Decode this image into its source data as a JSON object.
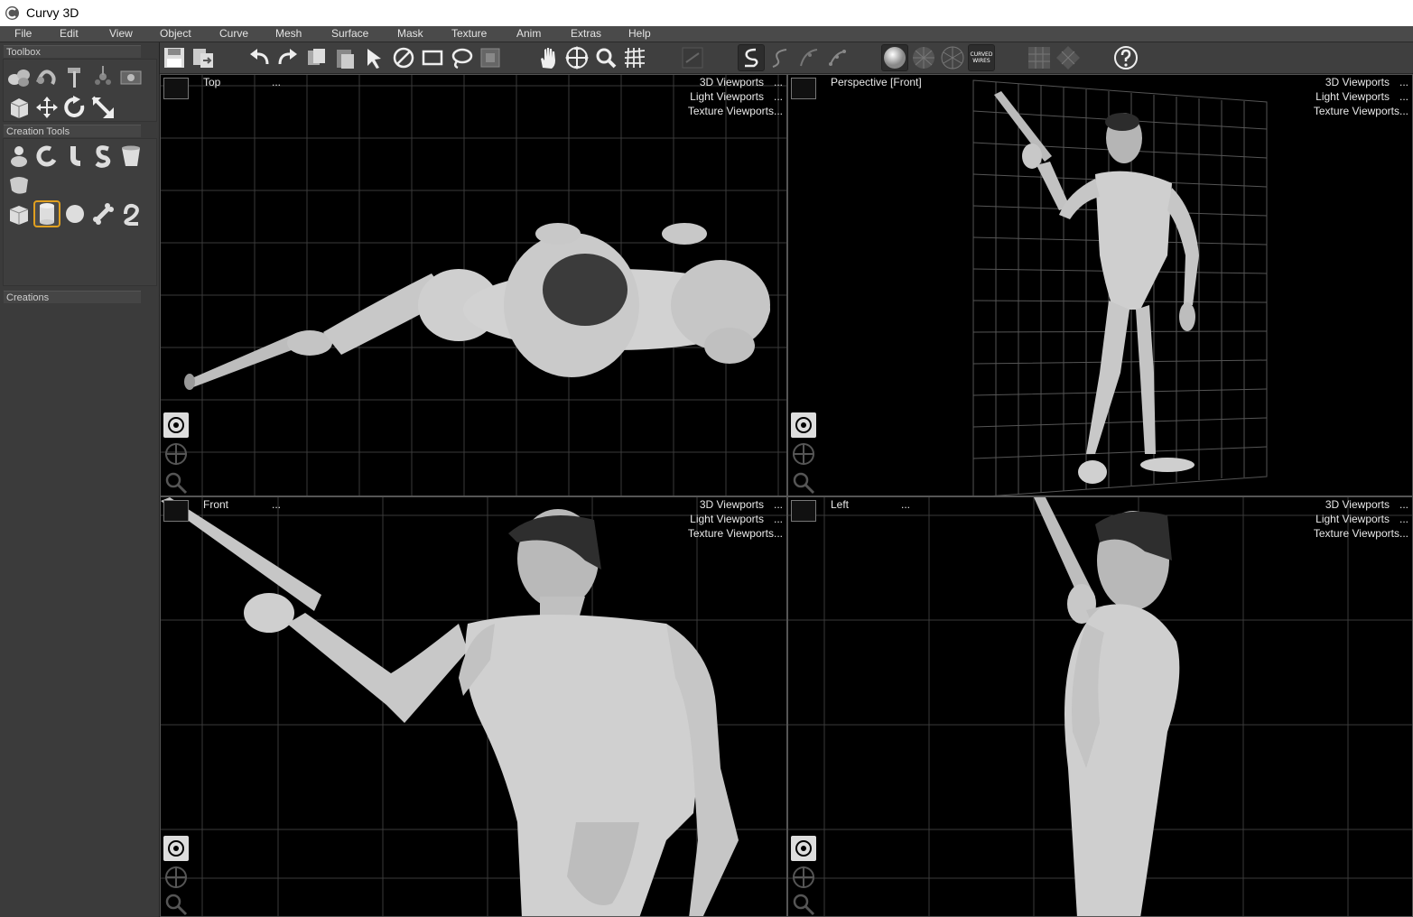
{
  "window": {
    "title": "Curvy 3D"
  },
  "menu": [
    "File",
    "Edit",
    "View",
    "Object",
    "Curve",
    "Mesh",
    "Surface",
    "Mask",
    "Texture",
    "Anim",
    "Extras",
    "Help"
  ],
  "sidebar": {
    "toolbox_label": "Toolbox",
    "creation_tools_label": "Creation Tools",
    "creations_label": "Creations"
  },
  "toolbar": {
    "curved_wires_label_line1": "CURVED",
    "curved_wires_label_line2": "WIRES"
  },
  "viewports": {
    "top": {
      "name": "Top",
      "ellipsis": "...",
      "menu1": "3D Viewports",
      "menu2": "Light Viewports",
      "menu3": "Texture Viewports...",
      "dots": "..."
    },
    "perspective": {
      "name": "Perspective [Front]",
      "menu1": "3D Viewports",
      "menu2": "Light Viewports",
      "menu3": "Texture Viewports...",
      "dots": "..."
    },
    "front": {
      "name": "Front",
      "ellipsis": "...",
      "menu1": "3D Viewports",
      "menu2": "Light Viewports",
      "menu3": "Texture Viewports...",
      "dots": "..."
    },
    "left": {
      "name": "Left",
      "ellipsis": "...",
      "menu1": "3D Viewports",
      "menu2": "Light Viewports",
      "menu3": "Texture Viewports...",
      "dots": "..."
    }
  },
  "colors": {
    "accent_selected": "#e0a020",
    "viewport_bg": "#000000",
    "grid": "#3a3a3a",
    "model": "#c8c8c8"
  }
}
